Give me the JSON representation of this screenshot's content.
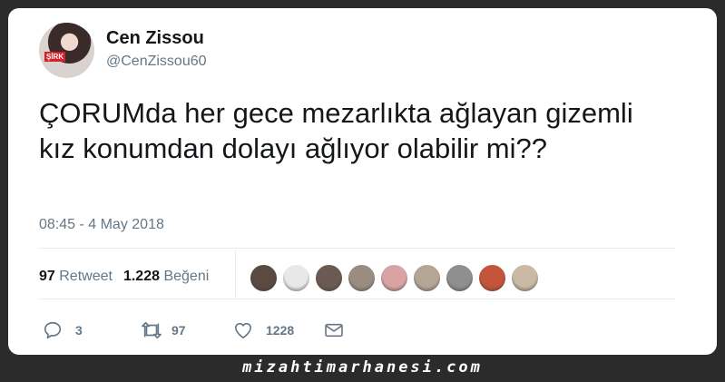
{
  "tweet": {
    "author_name": "Cen Zissou",
    "author_handle": "@CenZissou60",
    "avatar_tag": "ŞİRK",
    "text": "ÇORUMda her gece mezarlıkta ağlayan gizemli kız konumdan dolayı ağlıyor olabilir mi??",
    "timestamp": "08:45 - 4 May 2018"
  },
  "stats": {
    "retweet_count": "97",
    "retweet_label": "Retweet",
    "like_count": "1.228",
    "like_label": "Beğeni"
  },
  "likers": [
    {
      "name": "liker-avatar-1",
      "color": "#5a4a42"
    },
    {
      "name": "liker-avatar-2",
      "color": "#e8e8e8"
    },
    {
      "name": "liker-avatar-3",
      "color": "#6b5a52"
    },
    {
      "name": "liker-avatar-4",
      "color": "#9a8d80"
    },
    {
      "name": "liker-avatar-5",
      "color": "#d9a3a3"
    },
    {
      "name": "liker-avatar-6",
      "color": "#b5a595"
    },
    {
      "name": "liker-avatar-7",
      "color": "#8f8f8f"
    },
    {
      "name": "liker-avatar-8",
      "color": "#c4543a"
    },
    {
      "name": "liker-avatar-9",
      "color": "#c9b9a5"
    }
  ],
  "actions": {
    "reply_count": "3",
    "retweet_count": "97",
    "like_count": "1228"
  },
  "watermark": "mizahtimarhanesi.com",
  "colors": {
    "text": "#14171a",
    "secondary": "#657786",
    "background": "#2b2b2b"
  }
}
